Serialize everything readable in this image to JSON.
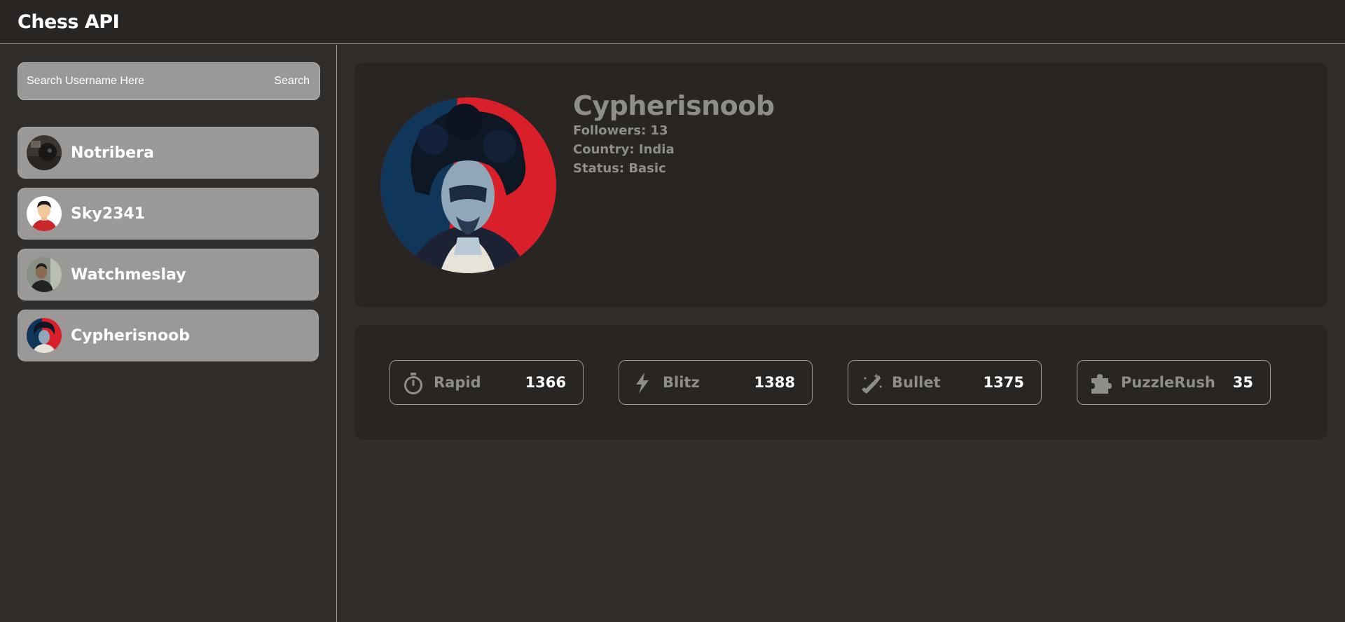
{
  "app": {
    "title": "Chess API"
  },
  "search": {
    "placeholder": "Search Username Here",
    "button_label": "Search"
  },
  "users": [
    {
      "name": "Notribera"
    },
    {
      "name": "Sky2341"
    },
    {
      "name": "Watchmeslay"
    },
    {
      "name": "Cypherisnoob"
    }
  ],
  "profile": {
    "username": "Cypherisnoob",
    "followers": "Followers: 13",
    "country": "Country: India",
    "status": "Status: Basic"
  },
  "ratings": [
    {
      "label": "Rapid",
      "value": "1366",
      "icon": "stopwatch-icon"
    },
    {
      "label": "Blitz",
      "value": "1388",
      "icon": "lightning-icon"
    },
    {
      "label": "Bullet",
      "value": "1375",
      "icon": "bullet-icon"
    },
    {
      "label": "PuzzleRush",
      "value": "35",
      "icon": "puzzle-icon"
    }
  ],
  "colors": {
    "background": "#312d2a",
    "card": "#282522",
    "sidebar_item": "#9b9997",
    "muted_text": "#8f8d8a",
    "accent_red": "#d9202a",
    "accent_navy": "#0f2a4a"
  }
}
